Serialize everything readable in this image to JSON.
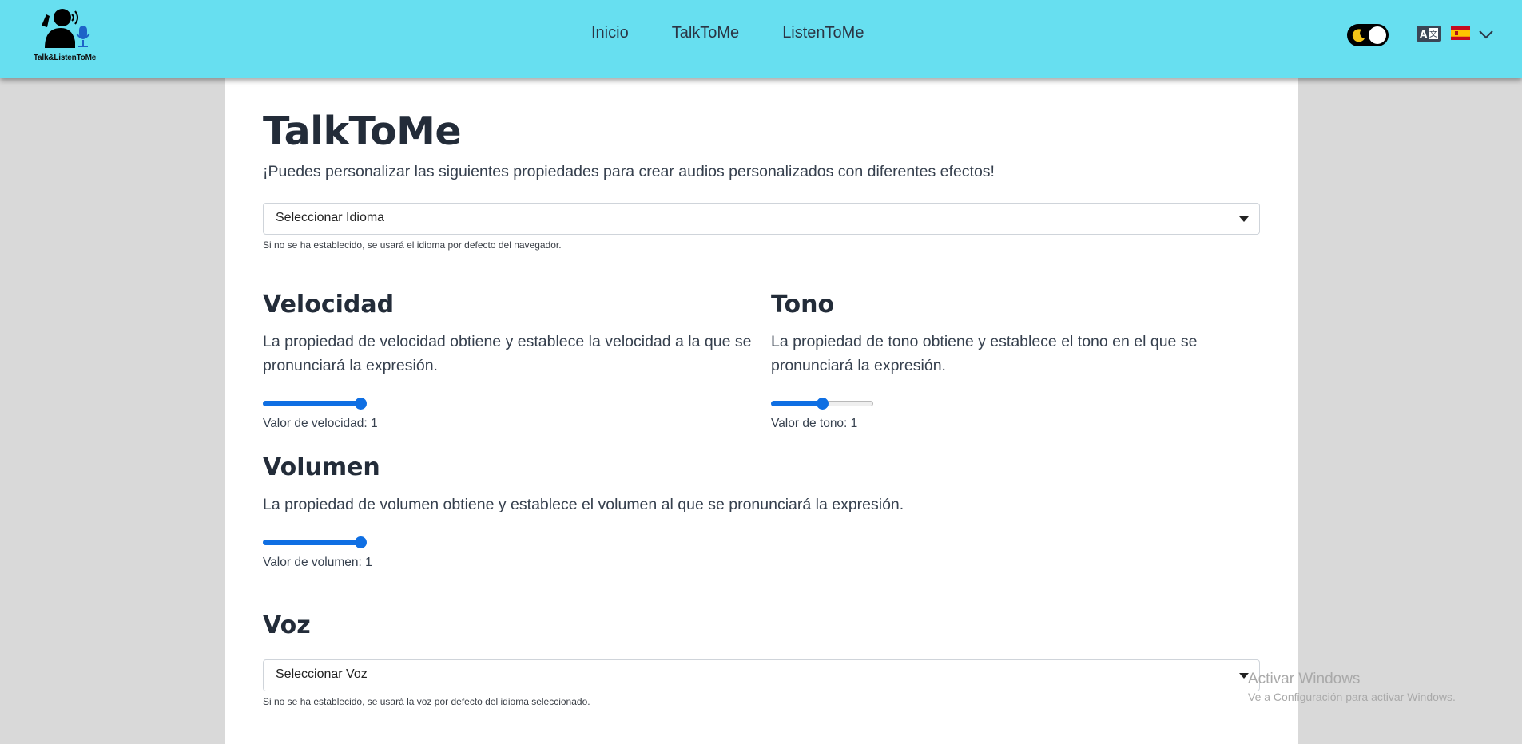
{
  "navbar": {
    "logo_text": "Talk&ListenToMe",
    "links": [
      "Inicio",
      "TalkToMe",
      "ListenToMe"
    ],
    "theme_toggle": "dark",
    "language_flag": "es"
  },
  "main": {
    "title": "TalkToMe",
    "intro": "¡Puedes personalizar las siguientes propiedades para crear audios personalizados con diferentes efectos!",
    "language_select": {
      "selected": "Seleccionar Idioma",
      "hint": "Si no se ha establecido, se usará el idioma por defecto del navegador."
    },
    "speed": {
      "title": "Velocidad",
      "description": "La propiedad de velocidad obtiene y establece la velocidad a la que se pronunciará la expresión.",
      "value_label": "Valor de velocidad: 1",
      "level": 0.95
    },
    "pitch": {
      "title": "Tono",
      "description": "La propiedad de tono obtiene y establece el tono en el que se pronunciará la expresión.",
      "value_label": "Valor de tono: 1",
      "level": 0.5
    },
    "volume": {
      "title": "Volumen",
      "description": "La propiedad de volumen obtiene y establece el volumen al que se pronunciará la expresión.",
      "value_label": "Valor de volumen: 1",
      "level": 0.95
    },
    "voice": {
      "title": "Voz",
      "selected": "Seleccionar Voz",
      "hint": "Si no se ha establecido, se usará la voz por defecto del idioma seleccionado."
    }
  },
  "watermark": {
    "title": "Activar Windows",
    "subtitle": "Ve a Configuración para activar Windows."
  },
  "colors": {
    "navbar_bg": "#67dff0",
    "page_bg": "#d9d9d9",
    "slider_accent": "#0f6fe3"
  }
}
